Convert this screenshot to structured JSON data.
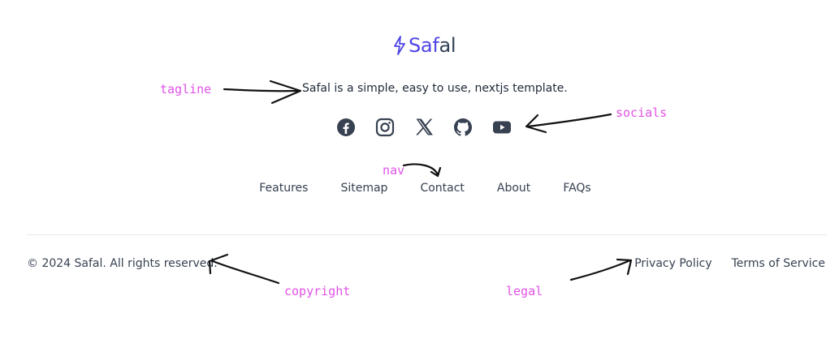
{
  "brand": {
    "name_part1": "Saf",
    "name_part2": "al",
    "colors": {
      "primary": "#4f46e5",
      "secondary": "#334155"
    }
  },
  "tagline": "Safal is a simple, easy to use, nextjs template.",
  "socials": [
    {
      "icon": "facebook-icon"
    },
    {
      "icon": "instagram-icon"
    },
    {
      "icon": "x-icon"
    },
    {
      "icon": "github-icon"
    },
    {
      "icon": "youtube-icon"
    }
  ],
  "nav": {
    "items": [
      {
        "label": "Features"
      },
      {
        "label": "Sitemap"
      },
      {
        "label": "Contact"
      },
      {
        "label": "About"
      },
      {
        "label": "FAQs"
      }
    ]
  },
  "footer": {
    "copyright": "© 2024 Safal. All rights reserved.",
    "legal": [
      {
        "label": "Privacy Policy"
      },
      {
        "label": "Terms of Service"
      }
    ]
  },
  "annotations": {
    "tagline": "tagline",
    "socials": "socials",
    "nav": "nav",
    "copyright": "copyright",
    "legal": "legal",
    "color": "#e052e6"
  }
}
